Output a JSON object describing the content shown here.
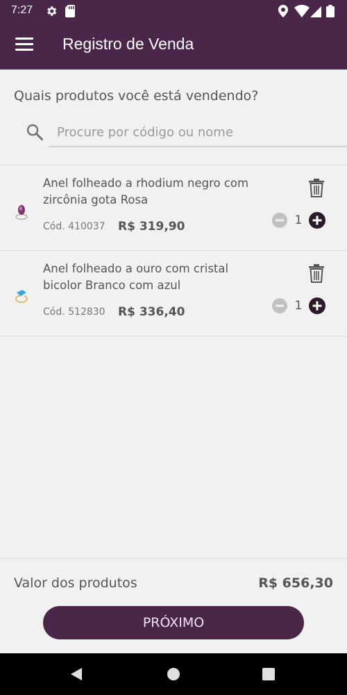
{
  "status_bar": {
    "time": "7:27"
  },
  "app_bar": {
    "title": "Registro de Venda"
  },
  "search": {
    "question": "Quais produtos você está vendendo?",
    "placeholder": "Procure por código ou nome",
    "value": ""
  },
  "products": [
    {
      "name": "Anel folheado a rhodium negro com zircônia gota Rosa",
      "code": "Cód. 410037",
      "price": "R$ 319,90",
      "quantity": "1"
    },
    {
      "name": "Anel folheado a ouro com cristal bicolor Branco com azul",
      "code": "Cód. 512830",
      "price": "R$ 336,40",
      "quantity": "1"
    }
  ],
  "footer": {
    "total_label": "Valor dos produtos",
    "total_value": "R$ 656,30",
    "next_label": "PRÓXIMO"
  },
  "colors": {
    "primary": "#4a2748",
    "background": "#f2f1f2"
  },
  "icons": [
    "settings-icon",
    "sd-card-icon",
    "location-icon",
    "wifi-icon",
    "signal-icon",
    "battery-icon",
    "menu-icon",
    "search-icon",
    "trash-icon",
    "minus-circle-icon",
    "plus-circle-icon",
    "back-icon",
    "home-icon",
    "recents-icon"
  ]
}
